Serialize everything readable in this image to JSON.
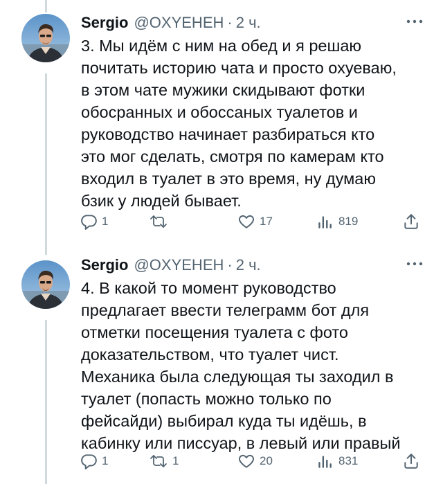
{
  "colors": {
    "text": "#0f1419",
    "muted": "#536471",
    "thread_line": "#cfd9de"
  },
  "tweets": [
    {
      "author_name": "Sergio",
      "handle": "@OXYEHEH",
      "separator": "·",
      "time": "2 ч.",
      "text_lines": [
        "3. Мы идём с ним на обед и я решаю",
        "почитать историю чата и просто охуеваю,",
        "в этом чате мужики скидывают фотки",
        "обосранных и обоссаных туалетов и",
        "руководство начинает разбираться кто",
        "это мог сделать, смотря по камерам кто",
        "входил в туалет в это время, ну думаю",
        "бзик у людей бывает."
      ],
      "replies": "1",
      "retweets": "",
      "likes": "17",
      "views": "819"
    },
    {
      "author_name": "Sergio",
      "handle": "@OXYEHEH",
      "separator": "·",
      "time": "2 ч.",
      "text_lines": [
        "4. В какой то момент руководство",
        "предлагает ввести телеграмм бот для",
        "отметки посещения туалета с фото",
        "доказательством, что туалет чист.",
        "Механика была следующая ты заходил в",
        "туалет (попасть можно только по",
        "фейсайди) выбирал куда ты идёшь, в",
        "кабинку или писсуар, в левый или правый"
      ],
      "replies": "1",
      "retweets": "1",
      "likes": "20",
      "views": "831"
    }
  ]
}
